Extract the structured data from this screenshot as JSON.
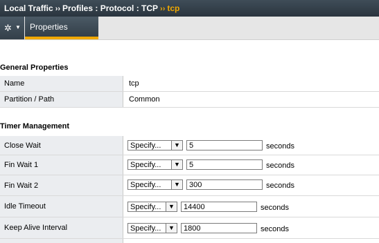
{
  "breadcrumb": {
    "local_traffic": "Local Traffic",
    "profiles_path": "Profiles : Protocol : TCP",
    "current": "tcp",
    "separator": "››"
  },
  "toolbar": {
    "gear_icon": "gear-icon",
    "tab_properties": "Properties"
  },
  "general": {
    "title": "General Properties",
    "rows": [
      {
        "label": "Name",
        "value": "tcp"
      },
      {
        "label": "Partition / Path",
        "value": "Common"
      }
    ]
  },
  "timer": {
    "title": "Timer Management",
    "rows": [
      {
        "label": "Close Wait",
        "select": "Specify...",
        "value": "5",
        "unit": "seconds"
      },
      {
        "label": "Fin Wait 1",
        "select": "Specify...",
        "value": "5",
        "unit": "seconds"
      },
      {
        "label": "Fin Wait 2",
        "select": "Specify...",
        "value": "300",
        "unit": "seconds"
      },
      {
        "label": "Idle Timeout",
        "select": "Specify...",
        "value": "14400",
        "unit": "seconds"
      },
      {
        "label": "Keep Alive Interval",
        "select": "Specify...",
        "value": "1800",
        "unit": "seconds"
      }
    ]
  },
  "colors": {
    "titlebar": "#2f3b45",
    "accent": "#f0a800",
    "label_bg": "#ebedf0"
  }
}
